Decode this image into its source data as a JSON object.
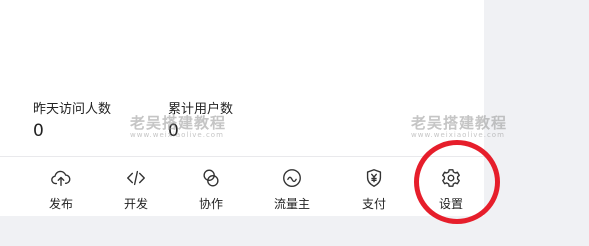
{
  "stats": [
    {
      "label": "昨天访问人数",
      "value": "0"
    },
    {
      "label": "累计用户数",
      "value": "0"
    }
  ],
  "toolbar": {
    "items": [
      {
        "label": "发布",
        "icon": "cloud-upload-icon"
      },
      {
        "label": "开发",
        "icon": "code-icon"
      },
      {
        "label": "协作",
        "icon": "collaboration-icon"
      },
      {
        "label": "流量主",
        "icon": "traffic-icon"
      },
      {
        "label": "支付",
        "icon": "payment-shield-icon"
      },
      {
        "label": "设置",
        "icon": "gear-icon"
      }
    ]
  },
  "watermarks": [
    {
      "title": "老吴搭建教程",
      "sub": "www.weixiaolive.com"
    },
    {
      "title": "老吴搭建教程",
      "sub": "www.weixiaolive.com"
    }
  ],
  "colors": {
    "highlight": "#e61e2b",
    "background": "#f0f1f4",
    "card": "#ffffff"
  }
}
